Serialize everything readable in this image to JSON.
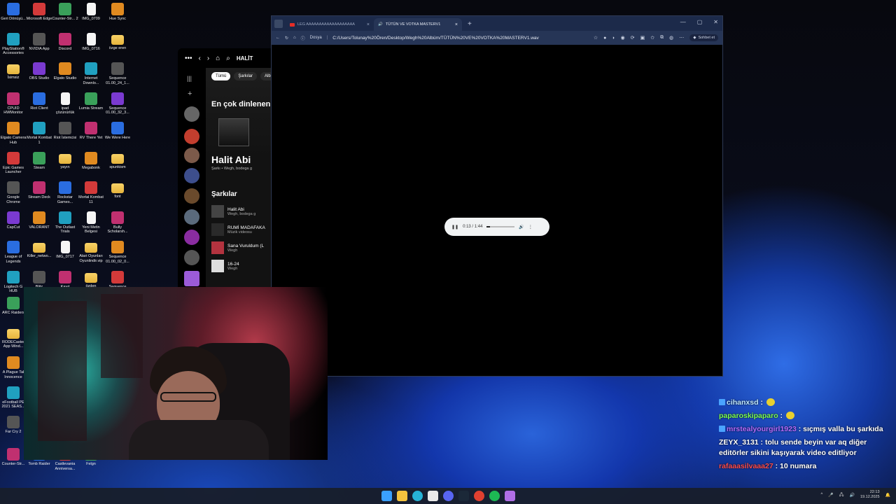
{
  "desktop_icons": [
    {
      "label": "Geri Dönüşü...",
      "kind": "app"
    },
    {
      "label": "Microsoft Edge",
      "kind": "app"
    },
    {
      "label": "Counter-Str... 2",
      "kind": "app"
    },
    {
      "label": "IMG_0709",
      "kind": "doc"
    },
    {
      "label": "Hue Sync",
      "kind": "app"
    },
    {
      "label": "PlayStation® Accessories",
      "kind": "app"
    },
    {
      "label": "NVIDIA App",
      "kind": "app"
    },
    {
      "label": "Discord",
      "kind": "app"
    },
    {
      "label": "IMG_0716",
      "kind": "doc"
    },
    {
      "label": "özge eren",
      "kind": "folder"
    },
    {
      "label": "İsimsiz",
      "kind": "folder"
    },
    {
      "label": "OBS Studio",
      "kind": "app"
    },
    {
      "label": "Elgato Studio",
      "kind": "app"
    },
    {
      "label": "Internet Downlo...",
      "kind": "app"
    },
    {
      "label": "Sequence 01.00_24_1...",
      "kind": "app"
    },
    {
      "label": "CPUID HWMonitor",
      "kind": "app"
    },
    {
      "label": "Riot Client",
      "kind": "app"
    },
    {
      "label": "ipad çözünürlük",
      "kind": "doc"
    },
    {
      "label": "Lumia Stream",
      "kind": "app"
    },
    {
      "label": "Sequence 01.00_32_3...",
      "kind": "app"
    },
    {
      "label": "Elgato Camera Hub",
      "kind": "app"
    },
    {
      "label": "Mortal Kombat 1",
      "kind": "app"
    },
    {
      "label": "Riot İstemcisi",
      "kind": "app"
    },
    {
      "label": "RV There Yet",
      "kind": "app"
    },
    {
      "label": "We Were Here",
      "kind": "app"
    },
    {
      "label": "Epic Games Launcher",
      "kind": "app"
    },
    {
      "label": "Steam",
      "kind": "app"
    },
    {
      "label": "yayın",
      "kind": "folder"
    },
    {
      "label": "Megabonk",
      "kind": "app"
    },
    {
      "label": "spunkism",
      "kind": "folder"
    },
    {
      "label": "Google Chrome",
      "kind": "app"
    },
    {
      "label": "Stream Deck",
      "kind": "app"
    },
    {
      "label": "Rockstar Games...",
      "kind": "app"
    },
    {
      "label": "Mortal Kombat 11",
      "kind": "app"
    },
    {
      "label": "font",
      "kind": "folder"
    },
    {
      "label": "CapCut",
      "kind": "app"
    },
    {
      "label": "VALORANT",
      "kind": "app"
    },
    {
      "label": "The Outlast Trials",
      "kind": "app"
    },
    {
      "label": "Yeni Metin Belgesi",
      "kind": "doc"
    },
    {
      "label": "Bully Scholarsh...",
      "kind": "app"
    },
    {
      "label": "League of Legends",
      "kind": "app"
    },
    {
      "label": "Killer_netwo...",
      "kind": "folder"
    },
    {
      "label": "IMG_0717",
      "kind": "doc"
    },
    {
      "label": "Atari Oyunları Oyunlindir.vip",
      "kind": "folder"
    },
    {
      "label": "Sequence 01.00_02_0...",
      "kind": "app"
    },
    {
      "label": "Logitech G HUB",
      "kind": "app"
    },
    {
      "label": "Blitz",
      "kind": "app"
    },
    {
      "label": "Kayıt",
      "kind": "app"
    },
    {
      "label": "özden",
      "kind": "folder"
    },
    {
      "label": "Sequence",
      "kind": "app"
    },
    {
      "label": "ARC Raiders",
      "kind": "app"
    },
    {
      "label": "RODECaster App Wind...",
      "kind": "folder"
    },
    {
      "label": "A Plague Tal Innocence",
      "kind": "app"
    },
    {
      "label": "eFootball PE 2021 SEAS...",
      "kind": "app"
    },
    {
      "label": "Far Cry 2",
      "kind": "app"
    },
    {
      "label": "Counter-Str...",
      "kind": "app"
    },
    {
      "label": "Tomb Raider",
      "kind": "app"
    },
    {
      "label": "Castlevania Anniversa...",
      "kind": "app"
    },
    {
      "label": "Felgn",
      "kind": "app"
    }
  ],
  "spotify": {
    "search_text": "HALİT",
    "chips": [
      "Tümü",
      "Şarkılar",
      "Albü"
    ],
    "top_heading": "En çok dinlenen s",
    "top_title": "Halit Abi",
    "top_meta": "Şarkı • Wegh, bodega g",
    "songs_heading": "Şarkılar",
    "songs": [
      {
        "title": "Halit Abi",
        "sub": "Wegh, bodega g"
      },
      {
        "title": "RUMİ MADAFAKA",
        "sub": "Müzik videosu"
      },
      {
        "title": "Sana Vuruldum (L",
        "sub": "Wegh"
      },
      {
        "title": "16-24",
        "sub": "Wegh"
      }
    ]
  },
  "browser": {
    "tab1_title": "LEG AAAAAAAAAAAAAAAAAAA",
    "tab2_title": "TÜTÜN VE VOTKA MASTERV1",
    "address_label": "Dosya",
    "url": "C:/Users/Tolunay%20Ören/Desktop/Wegh%20Albüm/TÜTÜN%20VE%20VOTKA%20MASTERV1.wav",
    "chat_button": "Sohbet et"
  },
  "player": {
    "time": "0:13 / 1:44",
    "progress": 0.125,
    "volume": 1.0
  },
  "chat": [
    {
      "user": "cihanxsd",
      "user_color": "#bfe8ff",
      "text": "",
      "emoji": true,
      "badge": true
    },
    {
      "user": "paparoskipaparo",
      "user_color": "#7cff4f",
      "text": "",
      "emoji": true,
      "badge": false
    },
    {
      "user": "mrstealyourgirl1923",
      "user_color": "#b46bff",
      "text": "sıçmış valla bu şarkıda",
      "emoji": false,
      "badge": true
    },
    {
      "user": "ZEYX_3131",
      "user_color": "#ffffff",
      "text": "tolu sende beyin var aq diğer editörler sikini kaşıyarak video editliyor",
      "emoji": false,
      "badge": false
    },
    {
      "user": "rafaaasilvaaa27",
      "user_color": "#ff4b4b",
      "text": "10 numara",
      "emoji": false,
      "badge": false
    }
  ],
  "taskbar": {
    "time": "22:13",
    "date": "19.12.2025",
    "apps": [
      "windows-start",
      "file-explorer",
      "edge",
      "notepad",
      "discord",
      "steam",
      "chrome",
      "spotify",
      "hue"
    ]
  },
  "colors": {
    "browser_frame": "#1c2a4a",
    "spotify_green": "#1db954",
    "chat_text": "#ffffff"
  }
}
